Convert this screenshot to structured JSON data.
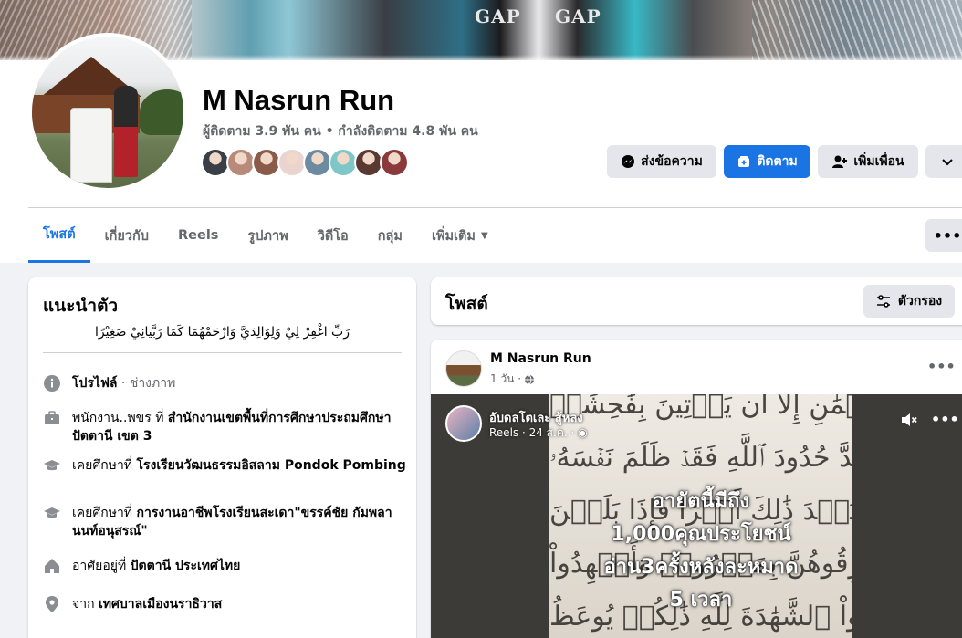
{
  "profile": {
    "name": "M Nasrun Run",
    "stats": "ผู้ติดตาม 3.9 พัน คน • กำลังติดตาม 4.8 พัน คน",
    "friend_colors": [
      "#3a3f45",
      "#b88a7a",
      "#8a5a4a",
      "#e9d4d0",
      "#6c8aa0",
      "#7ec6c8",
      "#5a3a30",
      "#8a3a3a"
    ]
  },
  "actions": {
    "message": "ส่งข้อความ",
    "follow": "ติดตาม",
    "add_friend": "เพิ่มเพื่อน"
  },
  "tabs": [
    {
      "label": "โพสต์"
    },
    {
      "label": "เกี่ยวกับ"
    },
    {
      "label": "Reels"
    },
    {
      "label": "รูปภาพ"
    },
    {
      "label": "วิดีโอ"
    },
    {
      "label": "กลุ่ม"
    },
    {
      "label": "เพิ่มเติม"
    }
  ],
  "intro": {
    "title": "แนะนำตัว",
    "bio": "رَبِّ اغْفِرْ لِيْ وَلِوَالِدَيَّ وَارْحَمْهُمَا كَمَا رَبَّيَانِيْ صَغِيْرًا",
    "items": [
      {
        "icon": "info-icon",
        "bold": "โปรไฟล์",
        "text": " · ช่างภาพ"
      },
      {
        "icon": "briefcase-icon",
        "prefix": "พนักงาน..พขร ที่ ",
        "bold": "สำนักงานเขตพื้นที่การศึกษาประถมศึกษาปัตตานี เขต 3"
      },
      {
        "icon": "graduation-cap-icon",
        "prefix": "เคยศึกษาที่ ",
        "bold": "โรงเรียนวัฒนธรรมอิสลาม Pondok Pombing"
      },
      {
        "icon": "graduation-cap-icon",
        "prefix": "เคยศึกษาที่ ",
        "bold": "การงานอาชีพโรงเรียนสะเดา\"ขรรค์ชัย กัมพลานนท์อนุสรณ์\""
      },
      {
        "icon": "home-icon",
        "prefix": "อาศัยอยู่ที่ ",
        "bold": "ปัตตานี ประเทศไทย"
      },
      {
        "icon": "location-pin-icon",
        "prefix": "จาก ",
        "bold": "เทศบาลเมืองนราธิวาส"
      }
    ]
  },
  "posts": {
    "title": "โพสต์",
    "filter": "ตัวกรอง"
  },
  "post": {
    "author": "M Nasrun Run",
    "time": "1 วัน ·",
    "reel": {
      "author": "อับดลโตเละ สู้หลง",
      "meta": "Reels · 24 ส.ค. ·",
      "overlay_lines": [
        "อายัตนี้มีถึง",
        "1,000คุณประโยชน์",
        "อ่าน3ครั้งหลังละหมาด",
        "5 เวลา"
      ]
    }
  }
}
